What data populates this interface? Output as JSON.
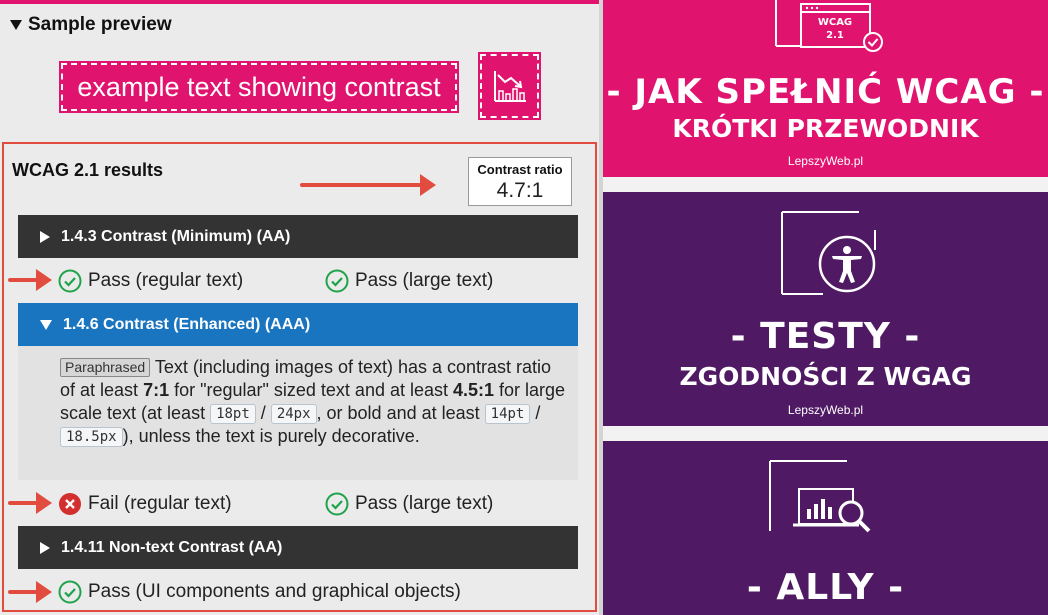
{
  "sample_preview": {
    "title": "Sample preview",
    "example_text": "example text showing contrast",
    "icon": "chart-decline-icon"
  },
  "results": {
    "title": "WCAG 2.1 results",
    "ratio_label": "Contrast ratio",
    "ratio_value": "4.7:1",
    "criteria": [
      {
        "label": "1.4.3 Contrast (Minimum) (AA)",
        "expanded": false,
        "outcomes": [
          {
            "status": "pass",
            "text": "Pass (regular text)"
          },
          {
            "status": "pass",
            "text": "Pass (large text)"
          }
        ]
      },
      {
        "label": "1.4.6 Contrast (Enhanced) (AAA)",
        "expanded": true,
        "description": {
          "tag": "Paraphrased",
          "part1": "Text (including images of text) has a contrast ratio of at least ",
          "bold1": "7:1",
          "part2": " for \"regular\" sized text and at least ",
          "bold2": "4.5:1",
          "part3": " for large scale text (at least ",
          "code1": "18pt",
          "sep1": " / ",
          "code2": "24px",
          "part4": ", or bold and at least ",
          "code3": "14pt",
          "sep2": " / ",
          "code4": "18.5px",
          "part5": "), unless the text is purely decorative."
        },
        "outcomes": [
          {
            "status": "fail",
            "text": "Fail (regular text)"
          },
          {
            "status": "pass",
            "text": "Pass (large text)"
          }
        ]
      },
      {
        "label": "1.4.11 Non-text Contrast (AA)",
        "expanded": false,
        "outcomes": [
          {
            "status": "pass",
            "text": "Pass (UI components and graphical objects)"
          }
        ]
      }
    ]
  },
  "cards": [
    {
      "badge": "WCAG\n2.1",
      "badge_line1": "WCAG",
      "badge_line2": "2.1",
      "icon": "wcag-checklist-icon",
      "title": "- JAK SPEŁNIĆ WCAG -",
      "subtitle": "KRÓTKI PRZEWODNIK",
      "site": "LepszyWeb.pl",
      "color": "#e0146f"
    },
    {
      "icon": "accessibility-person-icon",
      "title": "- TESTY -",
      "subtitle": "ZGODNOŚCI Z WGAG",
      "site": "LepszyWeb.pl",
      "color": "#4f1a63"
    },
    {
      "icon": "laptop-magnifier-icon",
      "title": "- ALLY -",
      "color": "#4f1a63"
    }
  ],
  "colors": {
    "accent": "#e0146f",
    "pass": "#1fa34a",
    "fail": "#d32f2f",
    "highlight": "#e14c3e",
    "blue": "#1a75c0"
  }
}
